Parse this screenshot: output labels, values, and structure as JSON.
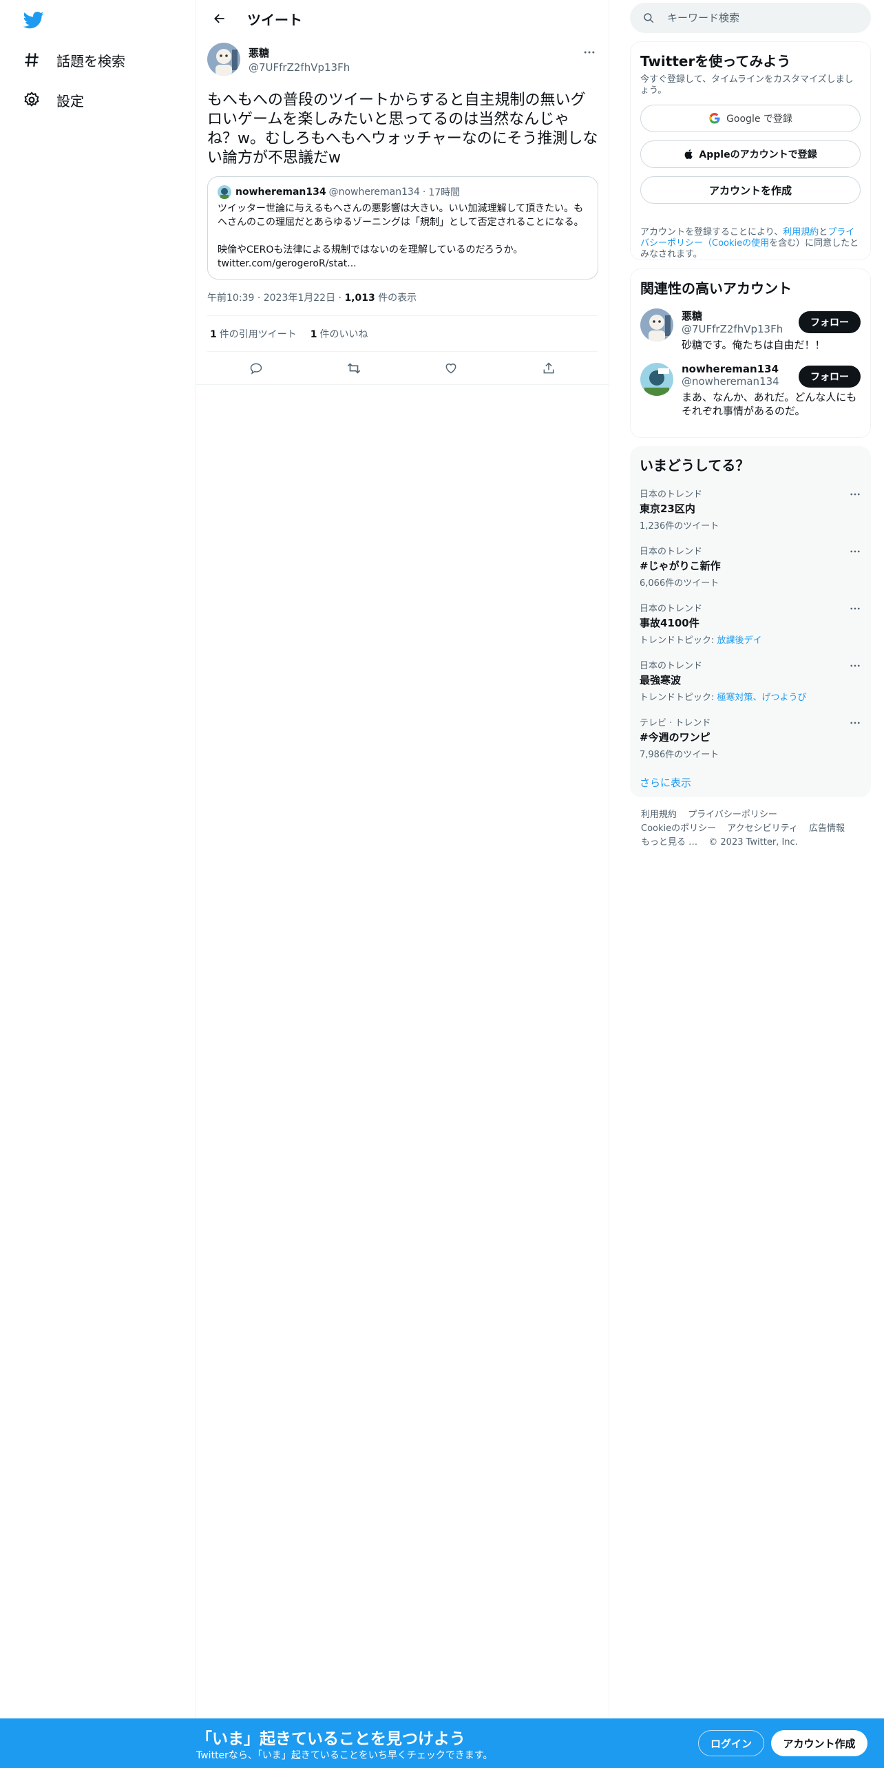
{
  "nav": {
    "items": [
      {
        "icon": "hashtag-icon",
        "label": "話題を検索"
      },
      {
        "icon": "gear-icon",
        "label": "設定"
      }
    ]
  },
  "header": {
    "title": "ツイート"
  },
  "tweet": {
    "author_name": "悪糖",
    "author_handle": "@7UFfrZ2fhVp13Fh",
    "text": "もへもへの普段のツイートからすると自主規制の無いグロいゲームを楽しみたいと思ってるのは当然なんじゃね？w。むしろもへもへウォッチャーなのにそう推測しない論方が不思議だw",
    "quote": {
      "author_name": "nowhereman134",
      "author_handle": "@nowhereman134",
      "time": "17時間",
      "text": "ツイッター世論に与えるもへさんの悪影響は大きい。いい加減理解して頂きたい。もへさんのこの理屈だとあらゆるゾーニングは「規制」として否定されることになる。\n\n映倫やCEROも法律による規制ではないのを理解しているのだろうか。\ntwitter.com/gerogeroR/stat..."
    },
    "time": "午前10:39",
    "date": "2023年1月22日",
    "views_count": "1,013",
    "views_label": "件の表示",
    "quote_count": "1",
    "quote_label": "件の引用ツイート",
    "like_count": "1",
    "like_label": "件のいいね"
  },
  "search": {
    "placeholder": "キーワード検索"
  },
  "signup": {
    "title": "Twitterを使ってみよう",
    "subtitle": "今すぐ登録して、タイムラインをカスタマイズしましょう。",
    "google_label": "Google で登録",
    "apple_label": "Appleのアカウントで登録",
    "create_label": "アカウントを作成",
    "legal_prefix": "アカウントを登録することにより、",
    "legal_terms": "利用規約",
    "legal_and": "と",
    "legal_privacy": "プライバシーポリシー",
    "legal_paren_open": "（",
    "legal_cookie": "Cookieの使用",
    "legal_suffix": "を含む）に同意したとみなされます。"
  },
  "related": {
    "title": "関連性の高いアカウント",
    "users": [
      {
        "name": "悪糖",
        "handle": "@7UFfrZ2fhVp13Fh",
        "bio": "砂糖です。俺たちは自由だ！！",
        "follow": "フォロー"
      },
      {
        "name": "nowhereman134",
        "handle": "@nowhereman134",
        "bio": "まあ、なんか、あれだ。どんな人にもそれぞれ事情があるのだ。",
        "follow": "フォロー"
      }
    ]
  },
  "trends": {
    "title": "いまどうしてる？",
    "items": [
      {
        "category": "日本のトレンド",
        "name": "東京23区内",
        "sub": "1,236件のツイート",
        "topic_prefix": "",
        "topic_links": ""
      },
      {
        "category": "日本のトレンド",
        "name": "#じゃがりこ新作",
        "sub": "6,066件のツイート",
        "topic_prefix": "",
        "topic_links": ""
      },
      {
        "category": "日本のトレンド",
        "name": "事故4100件",
        "sub": "",
        "topic_prefix": "トレンドトピック: ",
        "topic_links": "放課後デイ"
      },
      {
        "category": "日本のトレンド",
        "name": "最強寒波",
        "sub": "",
        "topic_prefix": "トレンドトピック: ",
        "topic_links": "極寒対策、げつようび"
      },
      {
        "category": "テレビ · トレンド",
        "name": "#今週のワンピ",
        "sub": "7,986件のツイート",
        "topic_prefix": "",
        "topic_links": ""
      }
    ],
    "show_more": "さらに表示"
  },
  "footer": {
    "links": [
      "利用規約",
      "プライバシーポリシー",
      "Cookieのポリシー",
      "アクセシビリティ",
      "広告情報",
      "もっと見る …"
    ],
    "copyright": "© 2023 Twitter, Inc."
  },
  "bottom_bar": {
    "title": "「いま」起きていることを見つけよう",
    "subtitle": "Twitterなら、「いま」起きていることをいち早くチェックできます。",
    "login": "ログイン",
    "signup": "アカウント作成"
  },
  "colors": {
    "accent": "#1d9bf0",
    "text": "#0f1419",
    "muted": "#536471",
    "border": "#eff3f4"
  }
}
